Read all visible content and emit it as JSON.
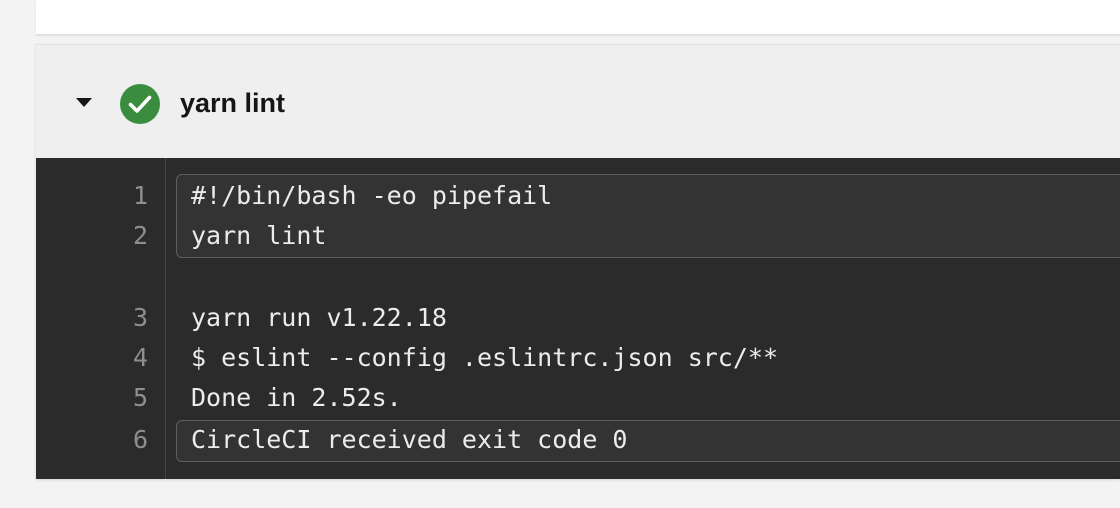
{
  "step": {
    "title": "yarn lint",
    "status": "success",
    "expanded": true,
    "status_color": "#3a8d3f",
    "icons": {
      "toggle": "caret-down-icon",
      "status": "check-circle-icon"
    }
  },
  "terminal": {
    "command_lines": [
      {
        "num": "1",
        "text": "#!/bin/bash -eo pipefail"
      },
      {
        "num": "2",
        "text": "yarn lint"
      }
    ],
    "output_lines": [
      {
        "num": "3",
        "text": "yarn run v1.22.18"
      },
      {
        "num": "4",
        "text": "$ eslint --config .eslintrc.json src/**"
      },
      {
        "num": "5",
        "text": "Done in 2.52s."
      }
    ],
    "exit_line": {
      "num": "6",
      "text": "CircleCI received exit code 0"
    }
  },
  "colors": {
    "terminal_bg": "#2b2b2b",
    "header_bg": "#efefef",
    "page_bg": "#f3f3f3"
  }
}
